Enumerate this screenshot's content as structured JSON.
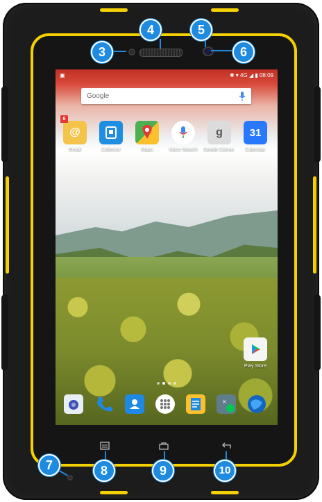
{
  "status_bar": {
    "network": "4G",
    "time": "08:09"
  },
  "search": {
    "brand": "Google"
  },
  "apps": [
    {
      "label": "Email",
      "badge": "6",
      "icon": "email-icon",
      "color": "#f3c34a"
    },
    {
      "label": "Collector",
      "icon": "collector-icon",
      "color": "#1f8ee0"
    },
    {
      "label": "Maps",
      "icon": "maps-icon",
      "color": "#4caf50"
    },
    {
      "label": "Voice Search",
      "icon": "mic-icon",
      "color": "#ffffff"
    },
    {
      "label": "Geode Conne...",
      "icon": "geode-icon",
      "color": "#dddddd"
    },
    {
      "label": "Calendar",
      "day": "31",
      "icon": "calendar-icon",
      "color": "#2979ff"
    }
  ],
  "play_store": {
    "label": "Play Store",
    "icon": "play-store-icon"
  },
  "dock": [
    {
      "icon": "camera-icon",
      "color": "#e8eef5"
    },
    {
      "icon": "phone-icon",
      "color": "#1e88e5"
    },
    {
      "icon": "contacts-icon",
      "color": "#1e88e5"
    },
    {
      "icon": "app-drawer-icon",
      "color": "#ffffff"
    },
    {
      "icon": "docs-icon",
      "color": "#fbc02d"
    },
    {
      "icon": "calculator-icon",
      "color": "#607d8b"
    },
    {
      "icon": "browser-icon",
      "color": "#1565c0"
    }
  ],
  "callouts": [
    "3",
    "4",
    "5",
    "6",
    "7",
    "8",
    "9",
    "10"
  ],
  "colors": {
    "accent": "#f4d000",
    "callout": "#1e8be0",
    "body": "#1c1c1c"
  }
}
